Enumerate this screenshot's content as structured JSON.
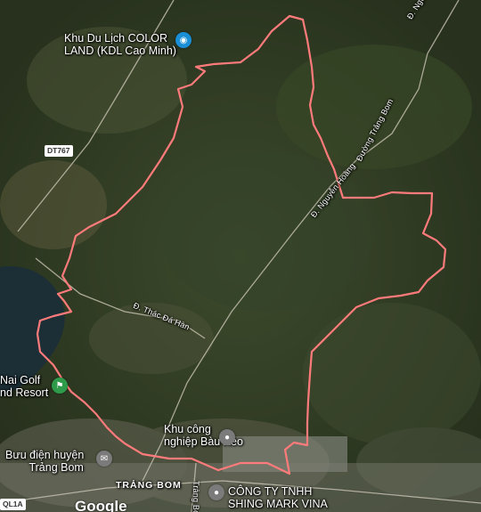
{
  "colors": {
    "boundary": "#ff7b7b",
    "pin_tourism": "#1a8fd6",
    "pin_golf": "#2e9b4a",
    "pin_place": "#7b7b7b",
    "road": "#c9c4b4"
  },
  "places": {
    "color_land": "Khu Du Lịch COLOR LAND (KDL Cao Minh)",
    "color_land_line1": "Khu Du Lịch COLOR",
    "color_land_line2": "LAND (KDL Cao Minh)",
    "golf_line1": "Nai Golf",
    "golf_line2": "nd Resort",
    "industrial_line1": "Khu công",
    "industrial_line2": "nghiệp Bàu Xéo",
    "post_line1": "Bưu điện huyện",
    "post_line2": "Trảng Bom",
    "company_line1": "CÔNG TY TNHH",
    "company_line2": "SHING MARK VINA",
    "town": "TRẢNG BOM"
  },
  "roads": {
    "dt767": "DT767",
    "ql1a": "QL1A",
    "nguyen_hoang_top": "Đ. Nguyễn Hoàng",
    "truong_bom": "Đường Trảng Bom",
    "nguyen_hoang_mid": "Đ. Nguyễn Hoàng",
    "thac_da_han": "Đ. Thác Đá Hàn",
    "trang_bom_street": "Trảng Bom"
  },
  "attribution": "Google",
  "icons": {
    "tourism": "camera-icon",
    "golf": "golf-icon",
    "place": "location-pin-icon",
    "post": "mail-icon"
  }
}
